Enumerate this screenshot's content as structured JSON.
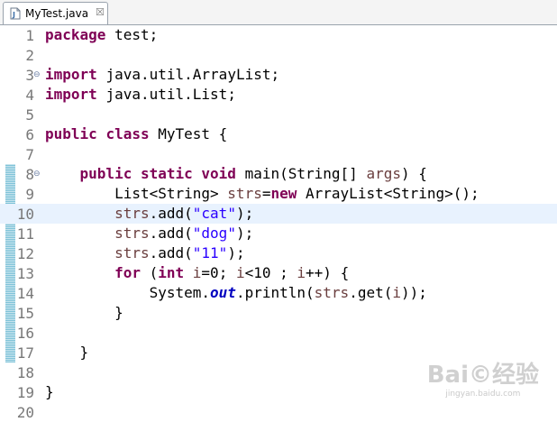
{
  "tab": {
    "label": "MyTest.java",
    "close_glyph": "☒",
    "icon": "java-file-icon"
  },
  "lines": [
    {
      "num": "1",
      "text": "package test;"
    },
    {
      "num": "2",
      "text": ""
    },
    {
      "num": "3",
      "text": "import java.util.ArrayList;",
      "fold": true
    },
    {
      "num": "4",
      "text": "import java.util.List;"
    },
    {
      "num": "5",
      "text": ""
    },
    {
      "num": "6",
      "text": "public class MyTest {"
    },
    {
      "num": "7",
      "text": ""
    },
    {
      "num": "8",
      "text": "    public static void main(String[] args) {",
      "fold": true
    },
    {
      "num": "9",
      "text": "        List<String> strs=new ArrayList<String>();"
    },
    {
      "num": "10",
      "text": "        strs.add(\"cat\");",
      "current": true
    },
    {
      "num": "11",
      "text": "        strs.add(\"dog\");"
    },
    {
      "num": "12",
      "text": "        strs.add(\"11\");"
    },
    {
      "num": "13",
      "text": "        for (int i=0; i<10 ; i++) {"
    },
    {
      "num": "14",
      "text": "            System.out.println(strs.get(i));"
    },
    {
      "num": "15",
      "text": "        }"
    },
    {
      "num": "16",
      "text": ""
    },
    {
      "num": "17",
      "text": "    }"
    },
    {
      "num": "18",
      "text": ""
    },
    {
      "num": "19",
      "text": "}"
    },
    {
      "num": "20",
      "text": ""
    }
  ],
  "fold_glyph": "⊖",
  "keywords": [
    "package",
    "import",
    "public",
    "class",
    "static",
    "void",
    "new",
    "for",
    "int"
  ],
  "static_fields": [
    "out"
  ],
  "variables": [
    "args",
    "strs",
    "i"
  ],
  "colors": {
    "keyword": "#7f0055",
    "string": "#2a00ff",
    "static_field": "#0000c0",
    "variable": "#6a3e3e",
    "line_number": "#787878",
    "current_line": "#e8f2fe",
    "change_marker": "#7fc3d8"
  },
  "change_marker_lines": [
    "8",
    "17"
  ],
  "watermark": {
    "main": "Bai©经验",
    "sub": "jingyan.baidu.com"
  }
}
